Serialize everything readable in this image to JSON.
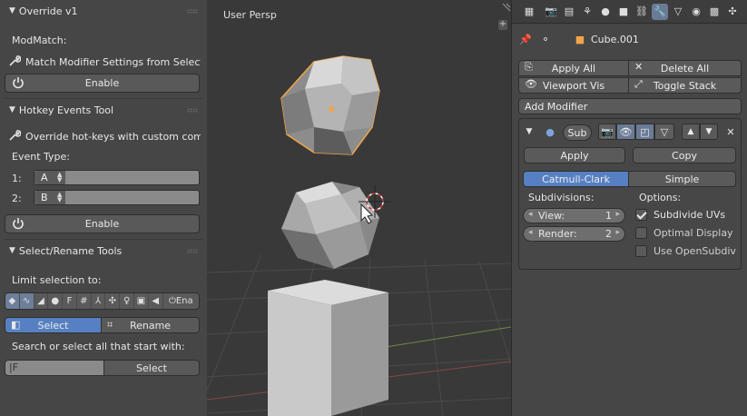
{
  "left_panel": {
    "override": {
      "title": "Override v1",
      "modmatch_label": "ModMatch:",
      "match_label": "Match Modifier Settings from Selected",
      "enable_label": "Enable"
    },
    "hotkey": {
      "title": "Hotkey Events Tool",
      "override_label": "Override hot-keys with custom com...",
      "event_type_label": "Event Type:",
      "row1_index": "1:",
      "row1_key": "A",
      "row2_index": "2:",
      "row2_key": "B",
      "enable_label": "Enable"
    },
    "select_rename": {
      "title": "Select/Rename Tools",
      "limit_label": "Limit selection to:",
      "strip_end_label": "Ena",
      "select_label": "Select",
      "rename_label": "Rename",
      "search_label": "Search or select all that start with:",
      "search_value": "F",
      "select_button_label": "Select"
    }
  },
  "viewport": {
    "label": "User Persp"
  },
  "properties": {
    "object_name": "Cube.001",
    "apply_all_label": "Apply All",
    "delete_all_label": "Delete All",
    "viewport_vis_label": "Viewport Vis",
    "toggle_stack_label": "Toggle Stack",
    "add_modifier_label": "Add Modifier",
    "modifier": {
      "name": "Sub",
      "apply_label": "Apply",
      "copy_label": "Copy",
      "type_catmull": "Catmull-Clark",
      "type_simple": "Simple",
      "subdivisions_label": "Subdivisions:",
      "options_label": "Options:",
      "view_label": "View:",
      "view_value": "1",
      "render_label": "Render:",
      "render_value": "2",
      "subdivide_uvs_label": "Subdivide UVs",
      "subdivide_uvs_checked": true,
      "optimal_display_label": "Optimal Display",
      "optimal_display_checked": false,
      "opensubdiv_label": "Use OpenSubdiv",
      "opensubdiv_checked": false
    }
  },
  "colors": {
    "panel_bg": "#464646",
    "viewport_bg": "#393939",
    "accent_blue": "#5680c2",
    "selection_orange": "#f1a54a"
  }
}
